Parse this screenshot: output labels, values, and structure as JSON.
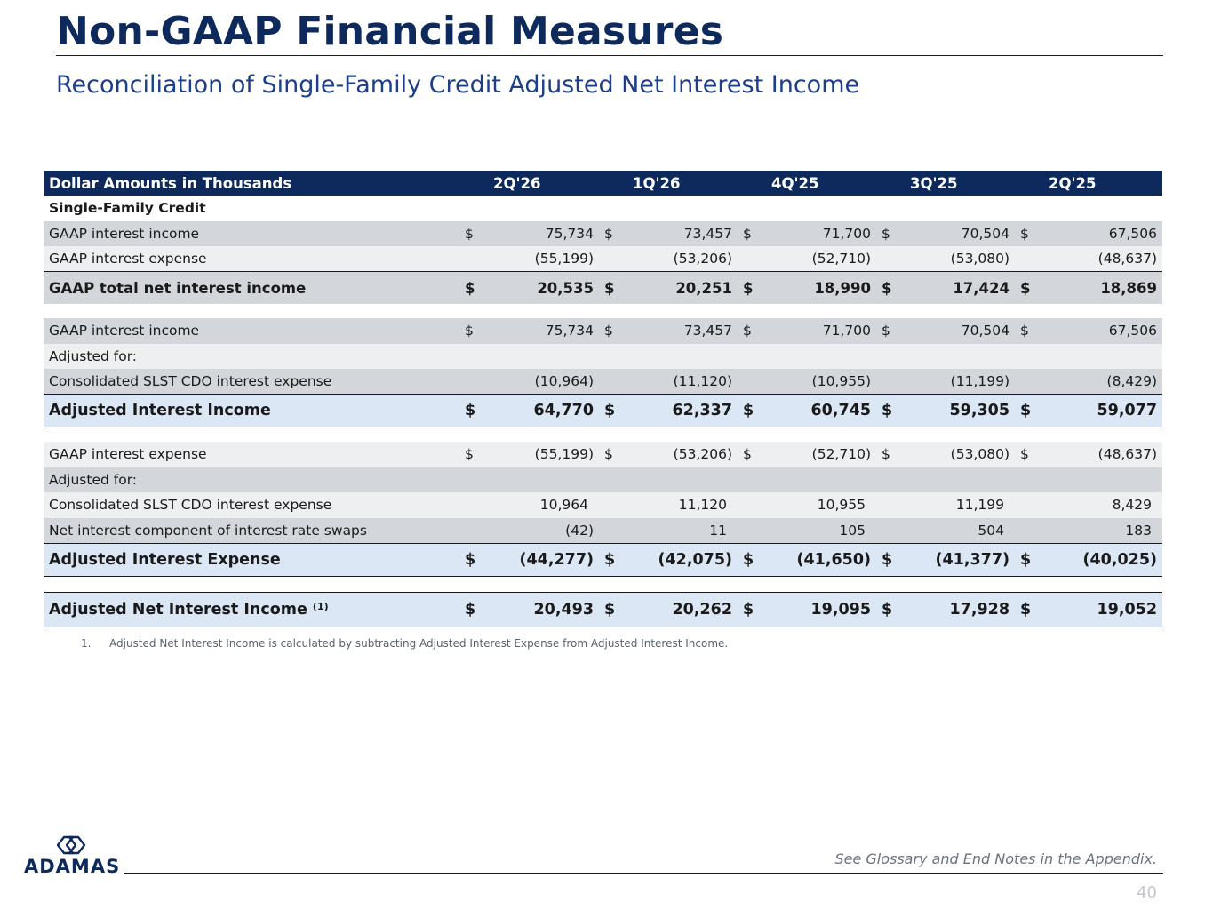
{
  "header": {
    "title": "Non-GAAP Financial Measures",
    "subtitle": "Reconciliation of Single-Family Credit Adjusted Net Interest Income"
  },
  "table": {
    "corner_label": "Dollar Amounts in Thousands",
    "periods": [
      "2Q'26",
      "1Q'26",
      "4Q'25",
      "3Q'25",
      "2Q'25"
    ],
    "section_label": "Single-Family Credit",
    "rows": [
      {
        "label": "GAAP interest income",
        "values": [
          "75,734",
          "73,457",
          "71,700",
          "70,504",
          "67,506"
        ],
        "currency": "$"
      },
      {
        "label": "GAAP interest expense",
        "values": [
          "(55,199)",
          "(53,206)",
          "(52,710)",
          "(53,080)",
          "(48,637)"
        ],
        "currency": ""
      },
      {
        "label": "GAAP total net interest income",
        "values": [
          "20,535",
          "20,251",
          "18,990",
          "17,424",
          "18,869"
        ],
        "currency": "$"
      },
      {
        "label": "GAAP interest income",
        "values": [
          "75,734",
          "73,457",
          "71,700",
          "70,504",
          "67,506"
        ],
        "currency": "$"
      },
      {
        "label": "Adjusted for:",
        "values": [
          "",
          "",
          "",
          "",
          ""
        ],
        "currency": ""
      },
      {
        "label": "Consolidated SLST CDO interest expense",
        "values": [
          "(10,964)",
          "(11,120)",
          "(10,955)",
          "(11,199)",
          "(8,429)"
        ],
        "currency": ""
      },
      {
        "label": "Adjusted Interest Income",
        "values": [
          "64,770",
          "62,337",
          "60,745",
          "59,305",
          "59,077"
        ],
        "currency": "$"
      },
      {
        "label": "GAAP interest expense",
        "values": [
          "(55,199)",
          "(53,206)",
          "(52,710)",
          "(53,080)",
          "(48,637)"
        ],
        "currency": "$"
      },
      {
        "label": "Adjusted for:",
        "values": [
          "",
          "",
          "",
          "",
          ""
        ],
        "currency": ""
      },
      {
        "label": "Consolidated SLST CDO interest expense",
        "values": [
          "10,964",
          "11,120",
          "10,955",
          "11,199",
          "8,429"
        ],
        "currency": ""
      },
      {
        "label": "Net interest component of interest rate swaps",
        "values": [
          "(42)",
          "11",
          "105",
          "504",
          "183"
        ],
        "currency": ""
      },
      {
        "label": "Adjusted Interest Expense",
        "values": [
          "(44,277)",
          "(42,075)",
          "(41,650)",
          "(41,377)",
          "(40,025)"
        ],
        "currency": "$"
      },
      {
        "label": "Adjusted Net Interest Income",
        "note_marker": "(1)",
        "values": [
          "20,493",
          "20,262",
          "19,095",
          "17,928",
          "19,052"
        ],
        "currency": "$"
      }
    ]
  },
  "footnote": {
    "number": "1.",
    "text": "Adjusted Net Interest Income is calculated by subtracting Adjusted Interest Expense from Adjusted Interest Income."
  },
  "footer": {
    "logo_text": "ADAMAS",
    "glossary_note": "See Glossary and End Notes in the Appendix.",
    "page_number": "40"
  },
  "colors": {
    "navy": "#0e2a5c",
    "subtitle_blue": "#1d3f8a",
    "row_gray": "#d3d6db",
    "row_light": "#eeeff1",
    "highlight_blue": "#dbe7f4"
  },
  "icons": [
    "adamas-logo-icon"
  ]
}
